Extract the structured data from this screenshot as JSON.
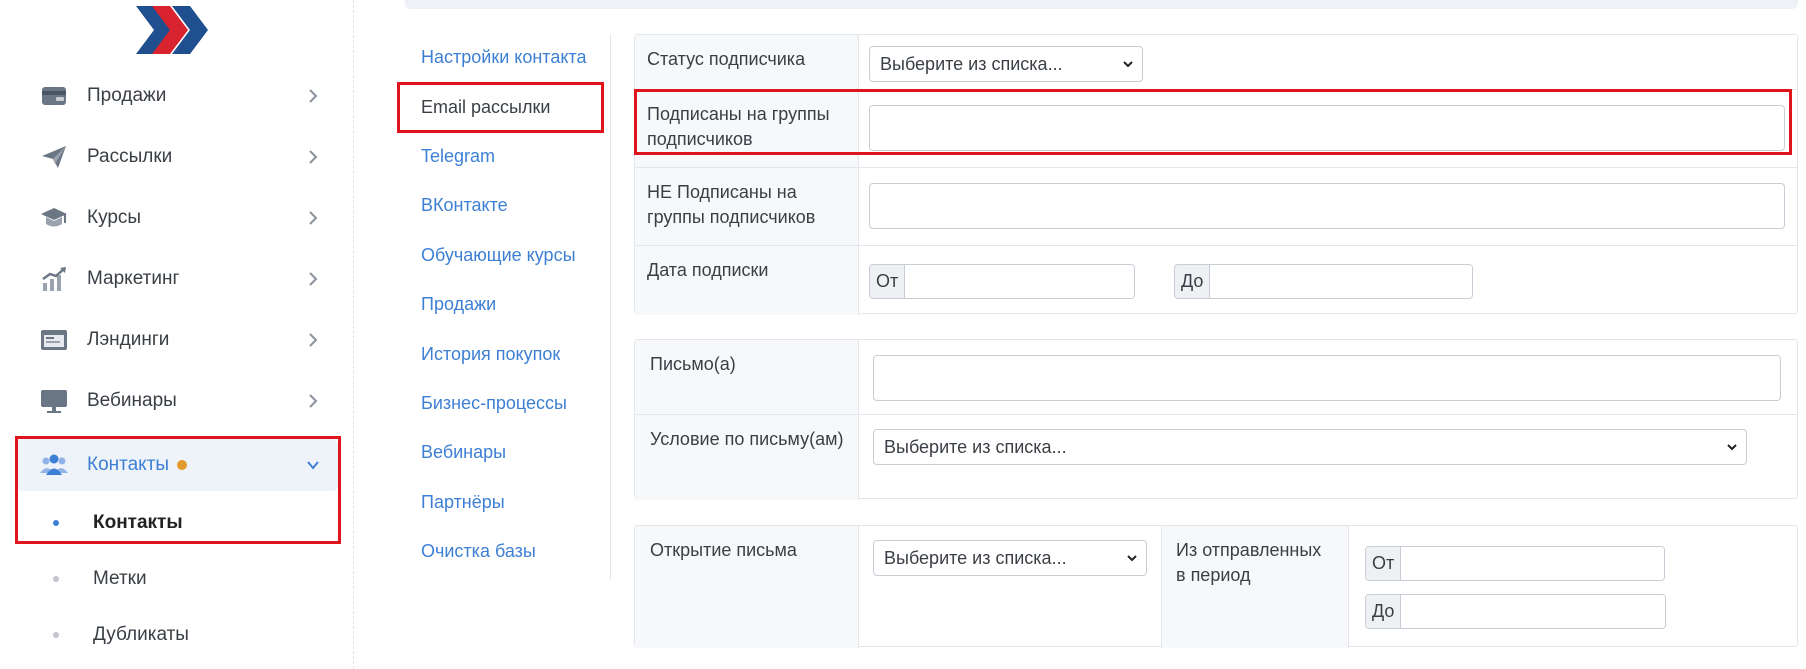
{
  "colors": {
    "accent_blue": "#3d7fd4",
    "logo_navy": "#1f4f8f",
    "logo_red": "#d9232e",
    "highlight_red": "#e0141d",
    "badge_orange": "#e39a2c"
  },
  "sidebar": {
    "logo_icon": "double-chevron-logo",
    "items": [
      {
        "label": "Продажи",
        "icon": "wallet-icon"
      },
      {
        "label": "Рассылки",
        "icon": "paper-plane-icon"
      },
      {
        "label": "Курсы",
        "icon": "graduation-cap-icon"
      },
      {
        "label": "Маркетинг",
        "icon": "growth-chart-icon"
      },
      {
        "label": "Лэндинги",
        "icon": "landing-page-icon"
      },
      {
        "label": "Вебинары",
        "icon": "monitor-icon"
      },
      {
        "label": "Контакты",
        "icon": "users-icon",
        "active": true,
        "expanded": true
      }
    ],
    "subitems": [
      {
        "label": "Контакты",
        "active": true
      },
      {
        "label": "Метки"
      },
      {
        "label": "Дубликаты"
      }
    ]
  },
  "tabs": [
    {
      "label": "Настройки контакта"
    },
    {
      "label": "Email рассылки",
      "active": true
    },
    {
      "label": "Telegram"
    },
    {
      "label": "ВКонтакте"
    },
    {
      "label": "Обучающие курсы"
    },
    {
      "label": "Продажи"
    },
    {
      "label": "История покупок"
    },
    {
      "label": "Бизнес-процессы"
    },
    {
      "label": "Вебинары"
    },
    {
      "label": "Партнёры"
    },
    {
      "label": "Очистка базы"
    }
  ],
  "form": {
    "subscription": {
      "status_label": "Статус подписчика",
      "status_select": "Выберите из списка...",
      "subscribed_groups_label": "Подписаны на группы подписчиков",
      "subscribed_groups_value": "",
      "not_subscribed_groups_label": "НЕ Подписаны на группы подписчиков",
      "not_subscribed_groups_value": "",
      "date_label": "Дата подписки",
      "date_from_prefix": "От",
      "date_to_prefix": "До"
    },
    "letters": {
      "letters_label": "Письмо(а)",
      "letters_value": "",
      "condition_label": "Условие по письму(ам)",
      "condition_select": "Выберите из списка..."
    },
    "opening": {
      "open_label": "Открытие письма",
      "open_select": "Выберите из списка...",
      "period_label": "Из отправленных в период",
      "from_prefix": "От",
      "to_prefix": "До"
    }
  }
}
